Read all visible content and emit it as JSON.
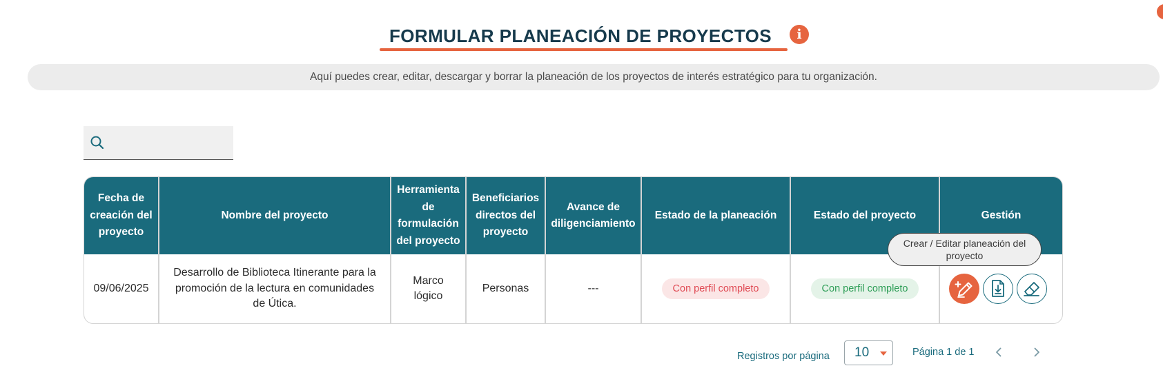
{
  "header": {
    "title": "FORMULAR PLANEACIÓN DE PROYECTOS",
    "info_icon": "info-icon",
    "info_glyph": "i",
    "description": "Aquí puedes crear, editar, descargar y borrar la planeación de los proyectos de interés estratégico para tu organización."
  },
  "search": {
    "placeholder": "",
    "value": "",
    "icon": "search-icon"
  },
  "table": {
    "columns": [
      "Fecha de creación del proyecto",
      "Nombre del proyecto",
      "Herramienta de formulación del proyecto",
      "Beneficiarios directos del proyecto",
      "Avance de diligenciamiento",
      "Estado de la planeación",
      "Estado del proyecto",
      "Gestión"
    ],
    "rows": [
      {
        "fecha": "09/06/2025",
        "nombre": "Desarrollo de Biblioteca Itinerante para la promoción de la lectura en comunidades de Útica.",
        "herramienta": "Marco lógico",
        "beneficiarios": "Personas",
        "avance": "---",
        "estado_planeacion": "Con perfil completo",
        "estado_proyecto": "Con perfil completo",
        "actions": [
          "edit-icon",
          "download-icon",
          "eraser-icon"
        ]
      }
    ]
  },
  "tooltip": {
    "text": "Crear / Editar planeación del proyecto"
  },
  "pagination": {
    "records_label": "Registros por página",
    "page_size": "10",
    "page_info": "Página 1 de 1"
  },
  "colors": {
    "primary": "#1a6b7d",
    "accent": "#e6643f",
    "status_red": "#e04a54",
    "status_green": "#2e9e57"
  }
}
